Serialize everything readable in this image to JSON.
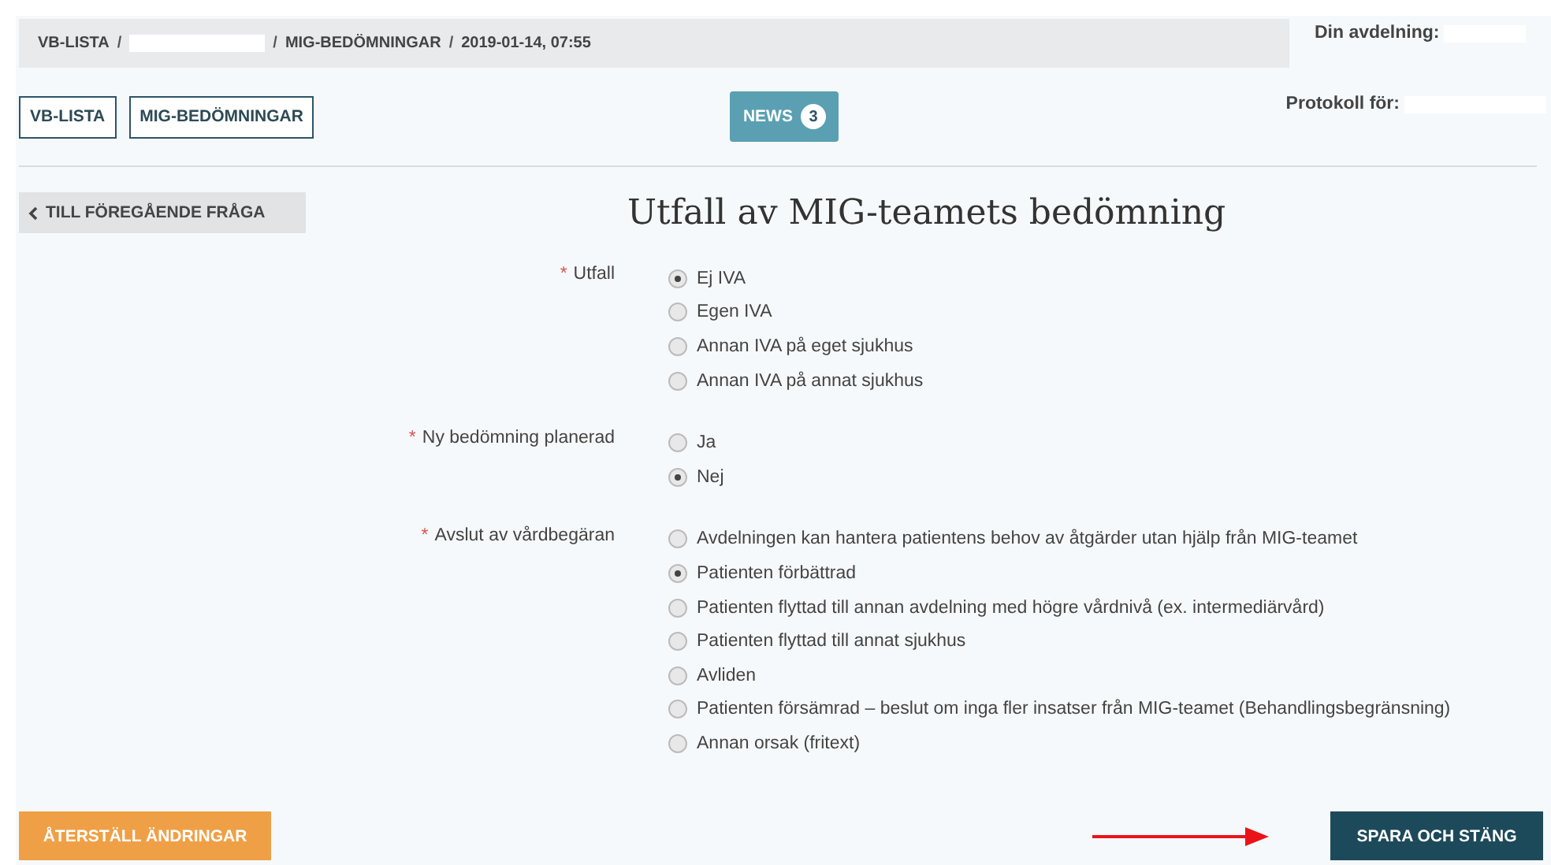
{
  "breadcrumb": [
    {
      "kind": "text",
      "text": "VB-LISTA"
    },
    {
      "kind": "separator",
      "text": "/"
    },
    {
      "kind": "redacted"
    },
    {
      "kind": "separator",
      "text": "/"
    },
    {
      "kind": "text",
      "text": "MIG-BEDÖMNINGAR"
    },
    {
      "kind": "separator",
      "text": "/"
    },
    {
      "kind": "text",
      "text": "2019-01-14, 07:55"
    }
  ],
  "department": {
    "label": "Din avdelning:"
  },
  "nav_buttons": [
    "VB-LISTA",
    "MIG-BEDÖMNINGAR"
  ],
  "news": {
    "label": "NEWS",
    "count": "3"
  },
  "protocol": {
    "label": "Protokoll för:"
  },
  "back_button": "TILL FÖREGÅENDE FRÅGA",
  "title": "Utfall av MIG-teamets bedömning",
  "questions": [
    {
      "label": "Utfall",
      "required_mark": "*",
      "options": [
        {
          "label": "Ej IVA",
          "selected": true
        },
        {
          "label": "Egen IVA",
          "selected": false
        },
        {
          "label": "Annan IVA på eget sjukhus",
          "selected": false
        },
        {
          "label": "Annan IVA på annat sjukhus",
          "selected": false
        }
      ]
    },
    {
      "label": "Ny bedömning planerad",
      "required_mark": "*",
      "options": [
        {
          "label": "Ja",
          "selected": false
        },
        {
          "label": "Nej",
          "selected": true
        }
      ]
    },
    {
      "label": "Avslut av vårdbegäran",
      "required_mark": "*",
      "options": [
        {
          "label": "Avdelningen kan hantera patientens behov av åtgärder utan hjälp från MIG-teamet",
          "selected": false
        },
        {
          "label": "Patienten förbättrad",
          "selected": true
        },
        {
          "label": "Patienten flyttad till annan avdelning med högre vårdnivå (ex. intermediärvård)",
          "selected": false
        },
        {
          "label": "Patienten flyttad till annat sjukhus",
          "selected": false
        },
        {
          "label": "Avliden",
          "selected": false
        },
        {
          "label": "Patienten försämrad – beslut om inga fler insatser från MIG-teamet (Behandlingsbegränsning)",
          "selected": false
        },
        {
          "label": "Annan orsak (fritext)",
          "selected": false
        }
      ]
    }
  ],
  "reset_button": "ÅTERSTÄLL ÄNDRINGAR",
  "save_button": "SPARA OCH STÄNG"
}
